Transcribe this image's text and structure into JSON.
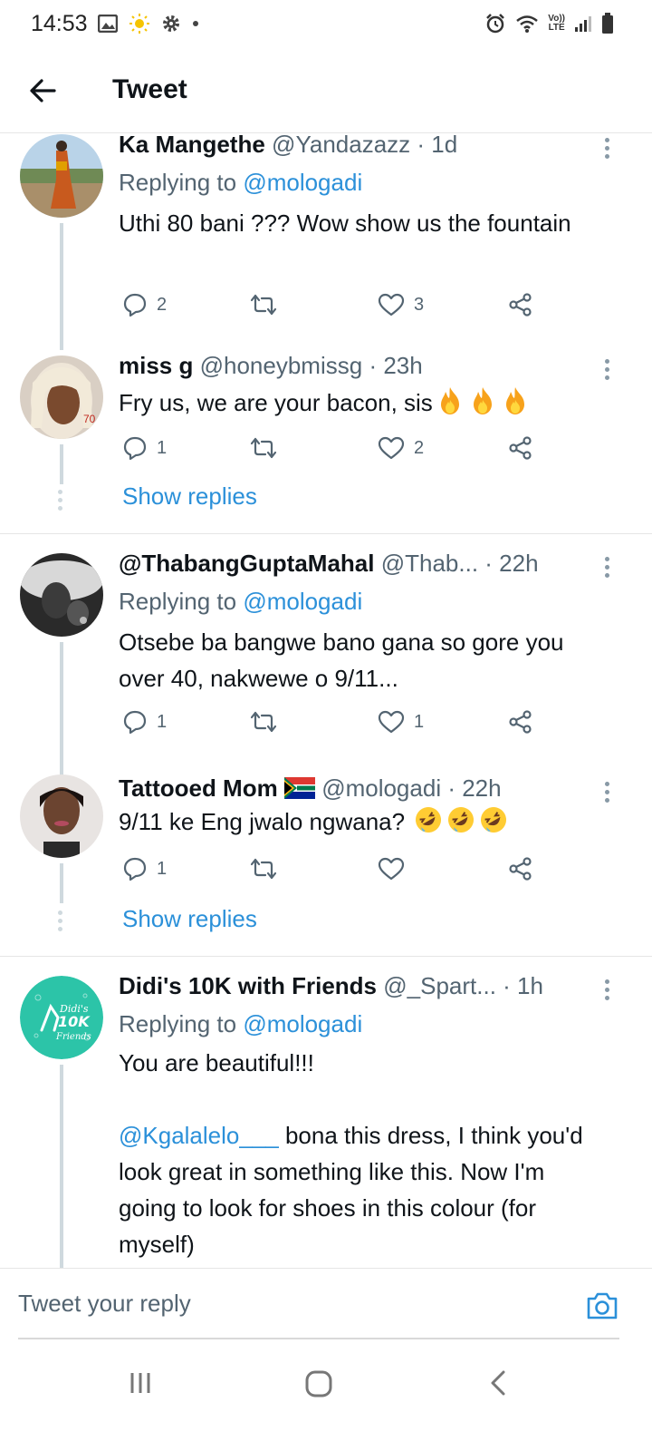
{
  "status_bar": {
    "time": "14:53",
    "network": "Vo)) LTE",
    "icons": [
      "gallery-icon",
      "sun-icon",
      "gear-icon",
      "dot-icon",
      "alarm-icon",
      "wifi-icon",
      "signal-icon",
      "battery-icon"
    ]
  },
  "header": {
    "title": "Tweet",
    "back_icon": "arrow-left-icon"
  },
  "tweets": [
    {
      "name": "Ka Mangethe",
      "handle": "@Yandazazz",
      "time": "· 1d",
      "replying_prefix": "Replying to ",
      "replying_to": "@mologadi",
      "text": "Uthi 80 bani ??? Wow show us the fountain",
      "replies": "2",
      "retweets": "",
      "likes": "3"
    },
    {
      "name": "miss g",
      "handle": "@honeybmissg",
      "time": "· 23h",
      "text": "Fry us, we are your bacon, sis",
      "emoji": "fire-emoji",
      "replies": "1",
      "retweets": "",
      "likes": "2",
      "show_replies": "Show replies"
    },
    {
      "name": "@ThabangGuptaMahal",
      "handle": "@Thab...",
      "time": "· 22h",
      "replying_prefix": "Replying to ",
      "replying_to": "@mologadi",
      "text": "Otsebe ba bangwe bano gana so gore you over 40, nakwewe o 9/11...",
      "replies": "1",
      "retweets": "",
      "likes": "1"
    },
    {
      "name": "Tattooed Mom",
      "flag": "south-africa-flag-emoji",
      "handle": "@mologadi",
      "time": "· 22h",
      "text": "9/11 ke Eng jwalo ngwana?",
      "emoji": "rofl-emoji",
      "replies": "1",
      "retweets": "",
      "likes": "",
      "show_replies": "Show replies"
    },
    {
      "name": "Didi's 10K with Friends",
      "handle": "@_Spart...",
      "time": "· 1h",
      "replying_prefix": "Replying to ",
      "replying_to": "@mologadi",
      "text_line1": "You are beautiful!!!",
      "mention": "@Kgalalelo___",
      "text_rest": " bona this dress, I think you'd look great in something like this. Now I'm going to look for shoes in this colour (for myself)",
      "avatar_logo_text": "Didi's 10K with Friends"
    }
  ],
  "reply_box": {
    "placeholder": "Tweet your reply",
    "camera_icon": "camera-icon"
  },
  "nav_bar": {
    "icons": [
      "recent-apps-icon",
      "home-icon",
      "back-icon"
    ]
  },
  "colors": {
    "link": "#2b90d9",
    "text": "#0f1419",
    "secondary": "#536471",
    "thread_line": "#cfd9de"
  }
}
